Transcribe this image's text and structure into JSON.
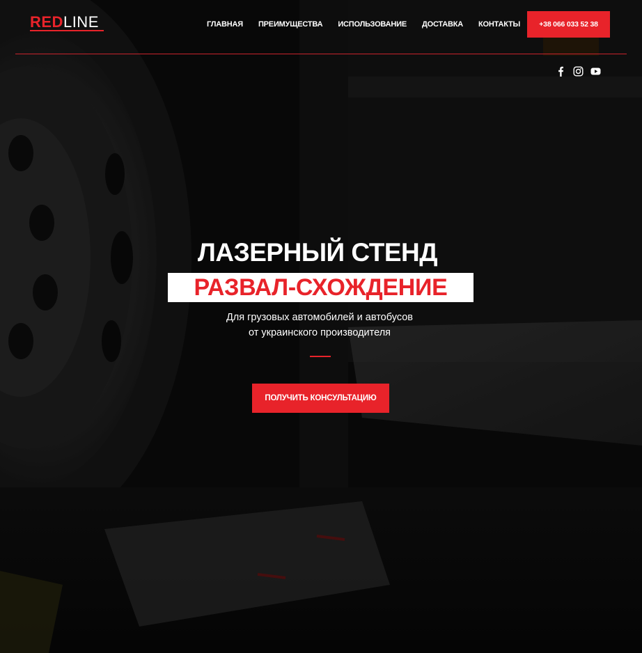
{
  "brand": {
    "logo_red": "RED",
    "logo_white": "LINE",
    "accent_color": "#e8232a"
  },
  "nav": {
    "items": [
      {
        "label": "ГЛАВНАЯ"
      },
      {
        "label": "ПРЕИМУЩЕСТВА"
      },
      {
        "label": "ИСПОЛЬЗОВАНИЕ"
      },
      {
        "label": "ДОСТАВКА"
      },
      {
        "label": "КОНТАКТЫ"
      }
    ],
    "phone": "+38 066 033 52 38"
  },
  "social": {
    "icons": [
      "facebook-icon",
      "instagram-icon",
      "youtube-icon"
    ]
  },
  "hero": {
    "title": "ЛАЗЕРНЫЙ СТЕНД",
    "subtitle": "РАЗВАЛ-СХОЖДЕНИЕ",
    "description_line1": "Для грузовых автомобилей и автобусов",
    "description_line2": "от украинского производителя",
    "cta": "ПОЛУЧИТЬ КОНСУЛЬТАЦИЮ"
  }
}
